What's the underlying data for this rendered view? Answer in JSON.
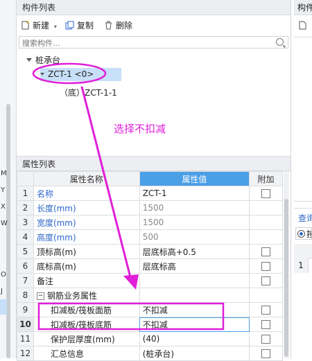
{
  "left_strip": {
    "chars": [
      "M",
      "Y",
      "X",
      "W",
      "O",
      "J"
    ]
  },
  "component_list": {
    "title": "构件列表",
    "toolbar": {
      "new_label": "新建",
      "copy_label": "复制",
      "delete_label": "删除"
    },
    "search_placeholder": "搜索构件...",
    "tree": {
      "root": "桩承台",
      "selected": "ZCT-1 <0>",
      "child": "（底）ZCT-1-1"
    }
  },
  "property_list": {
    "title": "属性列表",
    "headers": {
      "name": "属性名称",
      "value": "属性值",
      "extra": "附加"
    },
    "rows": [
      {
        "num": "1",
        "name": "名称",
        "value": "ZCT-1"
      },
      {
        "num": "2",
        "name": "长度(mm)",
        "value": "1500"
      },
      {
        "num": "3",
        "name": "宽度(mm)",
        "value": "1500"
      },
      {
        "num": "4",
        "name": "高度(mm)",
        "value": "500"
      },
      {
        "num": "5",
        "name": "顶标高(m)",
        "value": "层底标高+0.5"
      },
      {
        "num": "6",
        "name": "底标高(m)",
        "value": "层底标高"
      },
      {
        "num": "7",
        "name": "备注",
        "value": ""
      },
      {
        "num": "8",
        "name": "钢筋业务属性",
        "value": ""
      },
      {
        "num": "9",
        "name": "扣减板/筏板面筋",
        "value": "不扣减"
      },
      {
        "num": "10",
        "name": "扣减板/筏板底筋",
        "value": "不扣减"
      },
      {
        "num": "11",
        "name": "保护层厚度(mm)",
        "value": "(40)"
      },
      {
        "num": "12",
        "name": "汇总信息",
        "value": "(桩承台)"
      }
    ]
  },
  "right_panel": {
    "title": "构件",
    "query_label": "查询",
    "radio_label": "按",
    "row_num": "1"
  },
  "annotation": {
    "text": "选择不扣减",
    "color": "#e01ed8"
  }
}
